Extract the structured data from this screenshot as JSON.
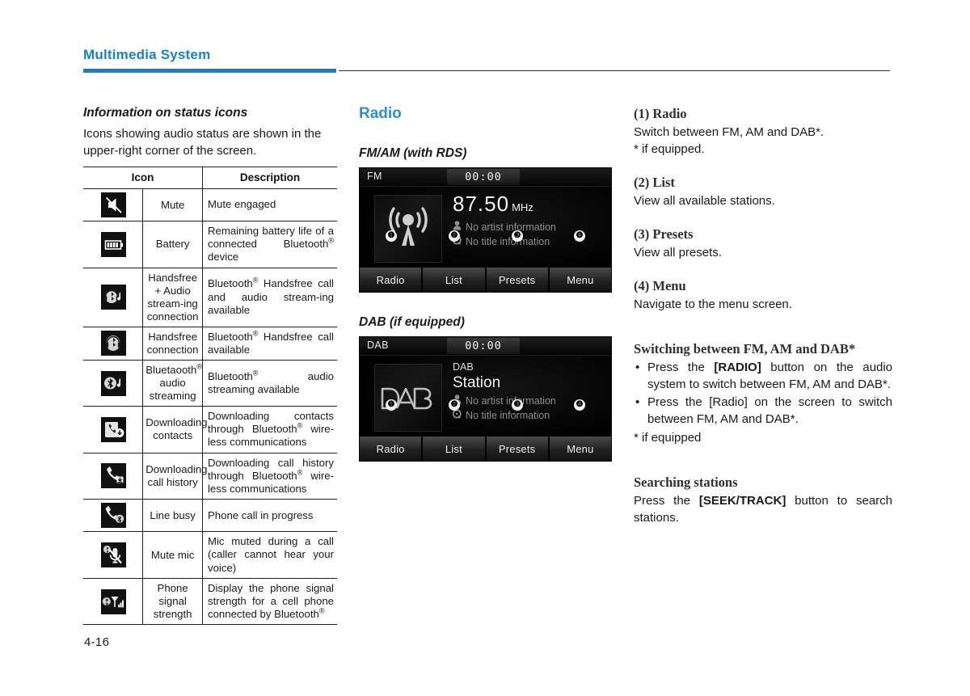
{
  "header": {
    "title": "Multimedia System",
    "page_number": "4-16"
  },
  "column1": {
    "section_title": "Information on status icons",
    "intro": "Icons showing audio status are shown in the upper-right corner of the screen.",
    "table": {
      "headers": [
        "Icon",
        "Description"
      ],
      "rows": [
        {
          "icon": "mute-icon",
          "name": "Mute",
          "description": "Mute engaged",
          "desc_parts": [
            {
              "t": "Mute engaged"
            }
          ]
        },
        {
          "icon": "battery-icon",
          "name": "Battery",
          "description": "Remaining battery life of a connected Bluetooth® device",
          "desc_parts": [
            {
              "t": "Remaining battery life of a connected Bluetooth"
            },
            {
              "t": "®",
              "sup": true
            },
            {
              "t": " device"
            }
          ]
        },
        {
          "icon": "handsfree-audio-streaming-icon",
          "name": "Handsfree + Audio stream-ing connection",
          "description": "Bluetooth® Handsfree call and audio stream-ing available",
          "desc_parts": [
            {
              "t": "Bluetooth"
            },
            {
              "t": "®",
              "sup": true
            },
            {
              "t": " Handsfree call and audio stream-ing available"
            }
          ]
        },
        {
          "icon": "handsfree-connection-icon",
          "name": "Handsfree connection",
          "description": "Bluetooth® Handsfree call available",
          "desc_parts": [
            {
              "t": "Bluetooth"
            },
            {
              "t": "®",
              "sup": true
            },
            {
              "t": " Handsfree call available"
            }
          ]
        },
        {
          "icon": "bluetooth-audio-streaming-icon",
          "name": "Bluetaooth® audio streaming",
          "description": "Bluetooth® audio streaming available",
          "desc_parts": [
            {
              "t": "Bluetooth"
            },
            {
              "t": "®",
              "sup": true
            },
            {
              "t": " audio streaming available"
            }
          ]
        },
        {
          "icon": "downloading-contacts-icon",
          "name": "Downloading contacts",
          "description": "Downloading contacts through Bluetooth® wire-less communications",
          "desc_parts": [
            {
              "t": "Downloading contacts through Bluetooth"
            },
            {
              "t": "®",
              "sup": true
            },
            {
              "t": " wire-less communications"
            }
          ]
        },
        {
          "icon": "downloading-call-history-icon",
          "name": "Downloading call history",
          "description": "Downloading call history through Bluetooth® wire-less communications",
          "desc_parts": [
            {
              "t": "Downloading call history through Bluetooth"
            },
            {
              "t": "®",
              "sup": true
            },
            {
              "t": " wire-less communications"
            }
          ]
        },
        {
          "icon": "line-busy-icon",
          "name": "Line busy",
          "description": "Phone call in progress",
          "desc_parts": [
            {
              "t": "Phone call in progress"
            }
          ]
        },
        {
          "icon": "mute-mic-icon",
          "name": "Mute mic",
          "description": "Mic muted during a call (caller cannot hear your voice)",
          "desc_parts": [
            {
              "t": "Mic muted during a call (caller cannot hear your voice)"
            }
          ]
        },
        {
          "icon": "phone-signal-strength-icon",
          "name": "Phone signal strength",
          "description": "Display the phone signal strength for a cell phone connected by Bluetooth®",
          "desc_parts": [
            {
              "t": "Display the phone signal strength for a cell phone connected by Bluetooth"
            },
            {
              "t": "®",
              "sup": true
            }
          ]
        }
      ]
    }
  },
  "column2": {
    "title": "Radio",
    "fm_section_title": "FM/AM (with RDS)",
    "dab_section_title": "DAB (if equipped)",
    "fm_screen": {
      "source": "FM",
      "clock": "00:00",
      "frequency": "87.50",
      "unit": "MHz",
      "artist_line": "No artist information",
      "title_line": "No title information",
      "artwork_icon": "radio-antenna-icon",
      "callouts": [
        "❶",
        "❷",
        "❸",
        "❹"
      ],
      "tabs": [
        "Radio",
        "List",
        "Presets",
        "Menu"
      ]
    },
    "dab_screen": {
      "source": "DAB",
      "clock": "00:00",
      "band_label": "DAB",
      "station_name": "Station",
      "artist_line": "No artist information",
      "title_line": "No title information",
      "artwork_icon": "dab-logo-icon",
      "callouts": [
        "❶",
        "❷",
        "❸",
        "❹"
      ],
      "tabs": [
        "Radio",
        "List",
        "Presets",
        "Menu"
      ]
    }
  },
  "column3": {
    "item1_head": "(1) Radio",
    "item1_body": "Switch between FM, AM and DAB*.",
    "item1_note": "* if equipped.",
    "item2_head": "(2) List",
    "item2_body": "View all available stations.",
    "item3_head": "(3) Presets",
    "item3_body": "View all presets.",
    "item4_head": "(4) Menu",
    "item4_body": "Navigate to the menu screen.",
    "switching_head": "Switching between FM, AM and DAB*",
    "switching_bullet1_pre": "Press the ",
    "switching_bullet1_key": "[RADIO]",
    "switching_bullet1_post": " button on the audio system to switch between FM, AM and DAB*.",
    "switching_bullet2": "Press the [Radio] on the screen to switch between FM, AM and DAB*.",
    "switching_note": "* if equipped",
    "searching_head": "Searching stations",
    "searching_pre": "Press the ",
    "searching_key": "[SEEK/TRACK]",
    "searching_post": " button to search stations."
  },
  "colors": {
    "brand_blue": "#1b7fc4",
    "heading_blue": "#2b8fd4",
    "screen_black": "#000000"
  }
}
